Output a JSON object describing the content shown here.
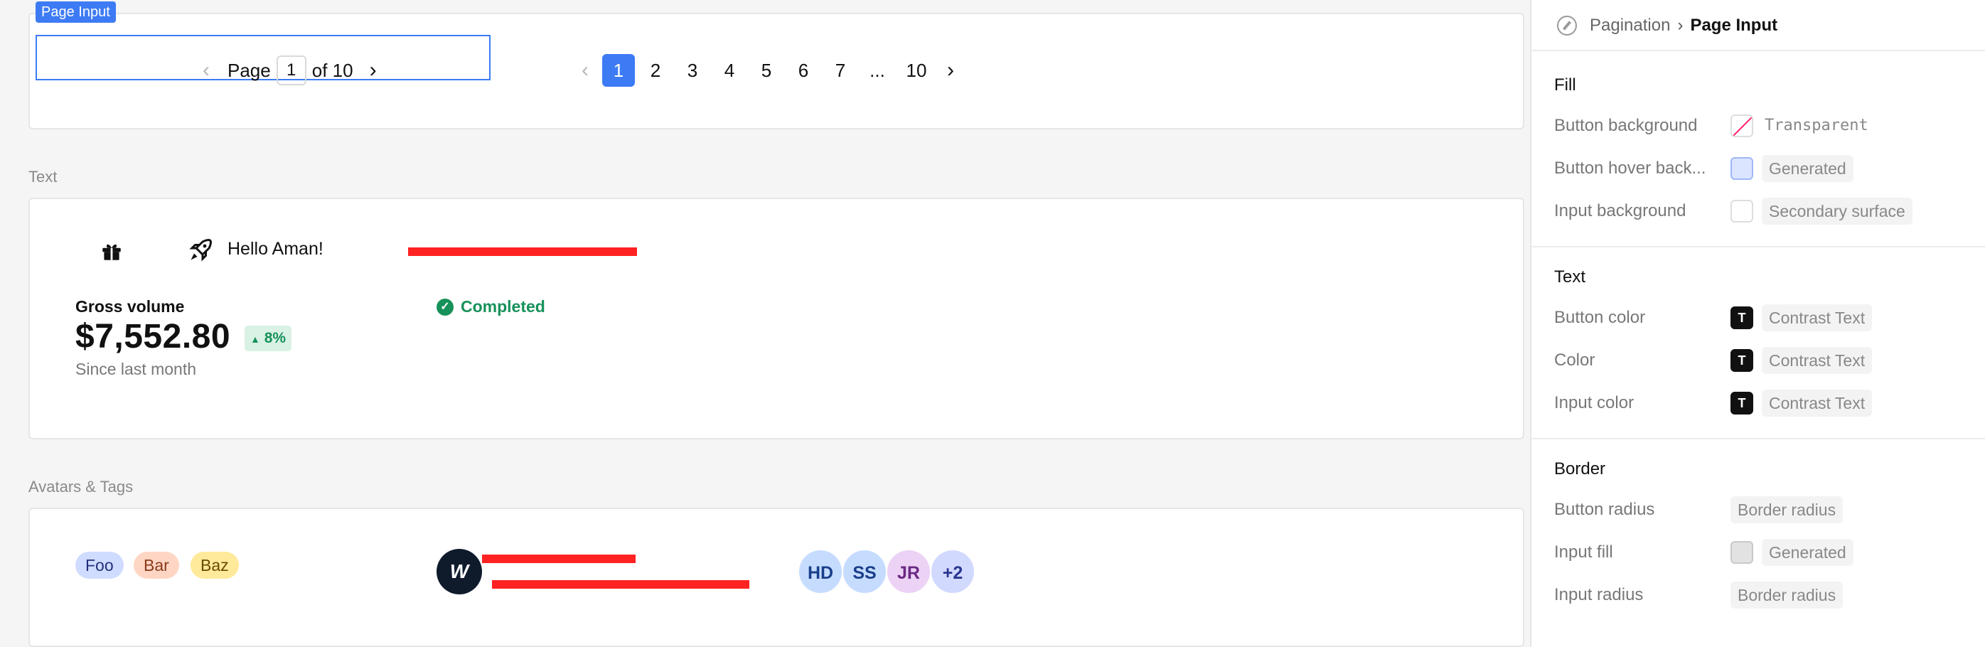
{
  "canvas": {
    "pagination": {
      "selection_label": "Page Input",
      "page_input": {
        "prefix": "Page",
        "value": "1",
        "suffix": "of 10"
      },
      "pager": {
        "pages": [
          "1",
          "2",
          "3",
          "4",
          "5",
          "6",
          "7"
        ],
        "ellipsis": "...",
        "last": "10",
        "current": "1"
      }
    },
    "text_section": {
      "label": "Text",
      "greeting": "Hello Aman!",
      "gross_label": "Gross volume",
      "amount": "$7,552.80",
      "delta": "8%",
      "since": "Since last month",
      "status": "Completed"
    },
    "avatars_section": {
      "label": "Avatars & Tags",
      "tags": [
        "Foo",
        "Bar",
        "Baz"
      ],
      "user_initial": "W",
      "avatars": [
        {
          "initials": "HD",
          "bg": "#c6dcff",
          "fg": "#1a3f8a"
        },
        {
          "initials": "SS",
          "bg": "#c6dcff",
          "fg": "#1a3f8a"
        },
        {
          "initials": "JR",
          "bg": "#ecd2f5",
          "fg": "#6a2a83"
        },
        {
          "initials": "+2",
          "bg": "#d2d9ff",
          "fg": "#2a3790"
        }
      ]
    }
  },
  "panel": {
    "breadcrumb": {
      "parent": "Pagination",
      "current": "Page Input"
    },
    "fill": {
      "title": "Fill",
      "rows": [
        {
          "label": "Button background",
          "value": "Transparent"
        },
        {
          "label": "Button hover back...",
          "value": "Generated"
        },
        {
          "label": "Input background",
          "value": "Secondary surface"
        }
      ]
    },
    "text": {
      "title": "Text",
      "rows": [
        {
          "label": "Button color",
          "value": "Contrast Text",
          "swatch": "T"
        },
        {
          "label": "Color",
          "value": "Contrast Text",
          "swatch": "T"
        },
        {
          "label": "Input color",
          "value": "Contrast Text",
          "swatch": "T"
        }
      ]
    },
    "border": {
      "title": "Border",
      "rows": [
        {
          "label": "Button radius",
          "value": "Border radius"
        },
        {
          "label": "Input fill",
          "value": "Generated"
        },
        {
          "label": "Input radius",
          "value": "Border radius"
        }
      ]
    }
  },
  "colors": {
    "accent": "#3d7bf5",
    "success": "#17915a",
    "redaction": "#ff2222"
  }
}
